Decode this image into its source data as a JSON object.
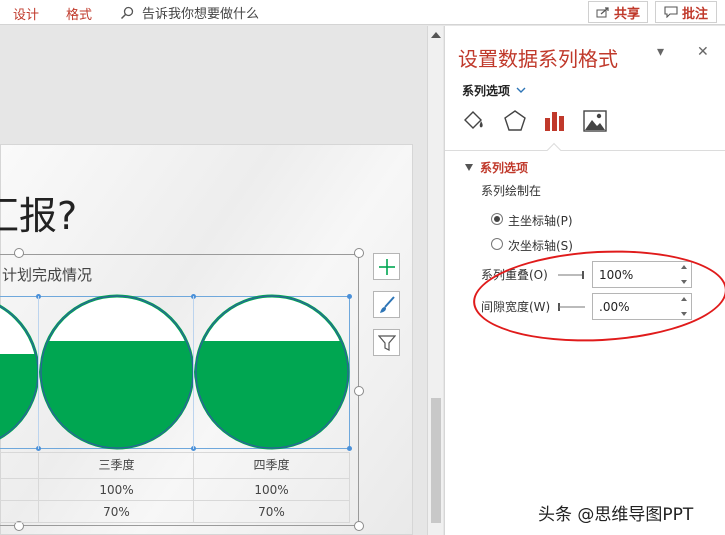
{
  "ribbon": {
    "tab_design": "设计",
    "tab_format": "格式",
    "tellme": "告诉我你想要做什么",
    "share": "共享",
    "comment": "批注"
  },
  "slide": {
    "title": "汇报?",
    "chart_title": "计划完成情况",
    "table": {
      "columns": [
        "三季度",
        "四季度"
      ],
      "row1": [
        "100%",
        "100%"
      ],
      "row2": [
        "70%",
        "70%"
      ]
    }
  },
  "chart_data": {
    "type": "bar",
    "categories": [
      "三季度",
      "四季度"
    ],
    "series": [
      {
        "values": [
          100,
          100
        ]
      },
      {
        "values": [
          70,
          70
        ]
      }
    ],
    "colors": {
      "fill": "#00a651",
      "outline": "#00a651"
    }
  },
  "pane": {
    "title": "设置数据系列格式",
    "tab": "系列选项",
    "section": "系列选项",
    "plot_on": "系列绘制在",
    "primary_axis": "主坐标轴(P)",
    "secondary_axis": "次坐标轴(S)",
    "overlap_label": "系列重叠(O)",
    "overlap_value": "100%",
    "gap_label": "间隙宽度(W)",
    "gap_value": ".00%"
  },
  "colors": {
    "accent": "#c0392b",
    "green": "#00a651",
    "annotation": "#e01b1b"
  },
  "watermark": "头条 @思维导图PPT"
}
